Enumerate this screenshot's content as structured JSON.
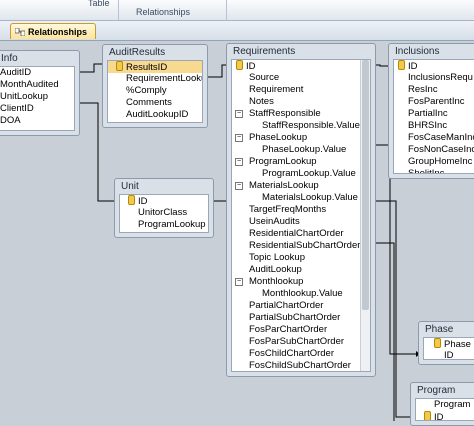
{
  "ribbon": {
    "group_left": "Table",
    "group_label": "Relationships"
  },
  "document_tab": {
    "label": "Relationships"
  },
  "tables": {
    "info": {
      "title": "Info",
      "fields": [
        "AuditID",
        "MonthAudited",
        "UnitLookup",
        "ClientID",
        "DOA"
      ]
    },
    "audit_results": {
      "title": "AuditResults",
      "fields": [
        "ResultsID",
        "RequirementLooku",
        "%Comply",
        "Comments",
        "AuditLookupID"
      ]
    },
    "unit": {
      "title": "Unit",
      "fields": [
        "ID",
        "UnitorClass",
        "ProgramLookup"
      ]
    },
    "requirements": {
      "title": "Requirements",
      "fields": [
        "ID",
        "Source",
        "Requirement",
        "Notes",
        "StaffResponsible",
        "StaffResponsible.Value",
        "PhaseLookup",
        "PhaseLookup.Value",
        "ProgramLookup",
        "ProgramLookup.Value",
        "MaterialsLookup",
        "MaterialsLookup.Value",
        "TargetFreqMonths",
        "UseinAudits",
        "ResidentialChartOrder",
        "ResidentialSubChartOrder",
        "Topic Lookup",
        "AuditLookup",
        "Monthlookup",
        "Monthlookup.Value",
        "PartialChartOrder",
        "PartialSubChartOrder",
        "FosParChartOrder",
        "FosParSubChartOrder",
        "FosChildChartOrder",
        "FosChildSubChartOrder"
      ]
    },
    "inclusions": {
      "title": "Inclusions",
      "fields": [
        "ID",
        "InclusionsRequ",
        "ResInc",
        "FosParentInc",
        "PartialInc",
        "BHRSInc",
        "FosCaseManInc",
        "FosNonCaseInc",
        "GroupHomeInc",
        "ShelitInc"
      ]
    },
    "phase": {
      "title": "Phase",
      "fields": [
        "Phase",
        "ID"
      ]
    },
    "program": {
      "title": "Program",
      "fields": [
        "Program",
        "ID"
      ]
    }
  }
}
